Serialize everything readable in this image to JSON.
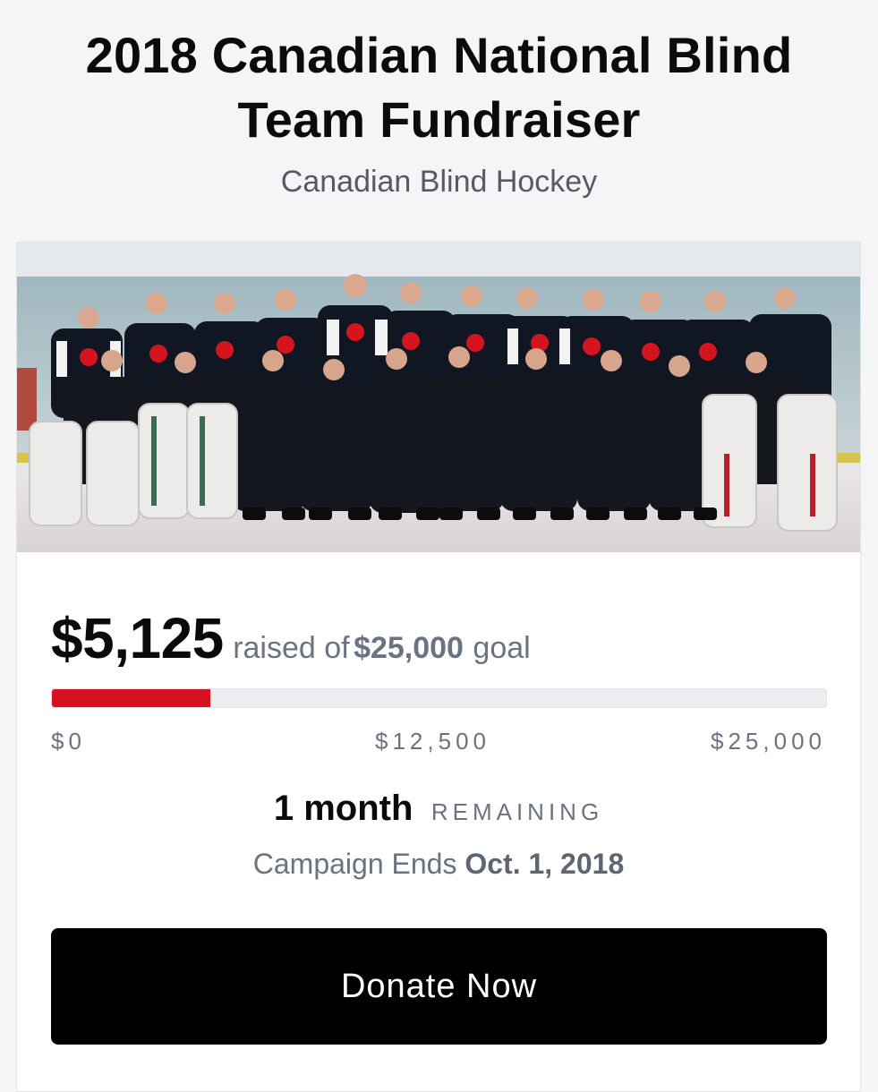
{
  "campaign": {
    "title": "2018 Canadian National Blind Team Fundraiser",
    "organizer": "Canadian Blind Hockey",
    "photo_alt": "team-photo",
    "raised": "$5,125",
    "raised_text": "raised of",
    "goal": "$25,000",
    "goal_suffix": "goal",
    "progress_fraction": 0.205,
    "scale_min": "$0",
    "scale_mid": "$12,500",
    "scale_max": "$25,000",
    "remaining_value": "1 month",
    "remaining_label": "REMAINING",
    "ends_prefix": "Campaign Ends",
    "ends_date": "Oct. 1, 2018",
    "donate_label": "Donate Now"
  },
  "colors": {
    "progress": "#d6121f",
    "button": "#000000"
  }
}
